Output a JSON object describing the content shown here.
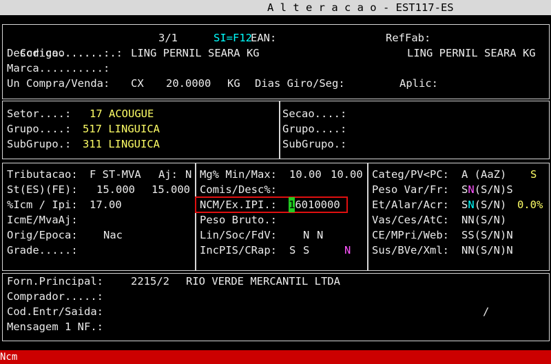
{
  "window_title": "A l t e r a c a o - EST117-ES",
  "product": {
    "codigo_label": "Codigo.........:",
    "codigo_value": "3/1",
    "si_f12": "SI=F12",
    "ean_label": "EAN:",
    "reffab_label": "RefFab:",
    "descricao_label": "Descricao......:",
    "descricao_value": "LING PERNIL SEARA KG",
    "descricao_right": "LING PERNIL SEARA KG",
    "marca_label": "Marca..........:",
    "uncv_label": "Un Compra/Venda:",
    "un_compra": "CX",
    "fator": "20.0000",
    "un_venda": "KG",
    "dias_giro_label": "Dias Giro/Seg:",
    "aplic_label": "Aplic:"
  },
  "classification": {
    "setor_label": "Setor....:",
    "setor_value": "17 ACOUGUE",
    "grupo_label": "Grupo....:",
    "grupo_value": "517 LINGUICA",
    "subgrupo_label": "SubGrupo.:",
    "subgrupo_value": "311 LINGUICA",
    "secao_label": "Secao....:",
    "grupo2_label": "Grupo....:",
    "subgrupo2_label": "SubGrupo.:"
  },
  "fiscal_left": {
    "tributacao_label": "Tributacao:",
    "tributacao_value": "F ST-MVA",
    "aj_label": "Aj:",
    "aj_value": "N",
    "st_label": "St(ES)(FE):",
    "st_value1": "15.000",
    "st_value2": "15.000",
    "icm_label": "%Icm / Ipi:",
    "icm_value": "17.00",
    "icme_label": "IcmE/MvaAj:",
    "orig_label": "Orig/Epoca:",
    "orig_value": "Nac",
    "grade_label": "Grade.....:"
  },
  "fiscal_mid": {
    "mg_label": "Mg% Min/Max:",
    "mg_value1": "10.00",
    "mg_value2": "10.00",
    "comis_label": "Comis/Desc%:",
    "ncm_label": "NCM/Ex.IPI.:",
    "ncm_cursor": "1",
    "ncm_rest": "6010000",
    "peso_bruto_label": "Peso Bruto.:",
    "lin_label": "Lin/Soc/FdV:",
    "lin_value1": "N",
    "lin_value2": "N",
    "inc_label": "IncPIS/CRap:",
    "inc_value1": "S",
    "inc_value2": "S",
    "inc_value3": "N"
  },
  "fiscal_right": {
    "categ_label": "Categ/PV<PC:",
    "categ_value": "A (AaZ)",
    "categ_flag": "S",
    "peso_label": "Peso Var/Fr:",
    "peso_s": "S",
    "peso_n": "N",
    "peso_rest": "(S/N)S",
    "et_label": "Et/Alar/Acr:",
    "et_s": "S",
    "et_n": "N",
    "et_rest": "(S/N)",
    "et_pct": "0.0%",
    "vas_label": "Vas/Ces/AtC:",
    "vas_value": "NN(S/N)",
    "ce_label": "CE/MPri/Web:",
    "ce_value": "SS(S/N)N",
    "sus_label": "Sus/BVe/Xml:",
    "sus_value": "NN(S/N)N"
  },
  "supplier": {
    "forn_label": "Forn.Principal:",
    "forn_code": "2215/2",
    "forn_name": "RIO VERDE MERCANTIL LTDA",
    "comprador_label": "Comprador.....:",
    "cod_label": "Cod.Entr/Saida:",
    "cod_slash": "/",
    "msg_label": "Mensagem 1 NF.:"
  },
  "status_bar": "Ncm",
  "colors": {
    "title_bg": "#d9d9d9",
    "status_bg": "#cc0000",
    "highlight_border": "#e01010",
    "cursor_bg": "#22cc22",
    "yellow": "#ffff66",
    "cyan": "#00ffff",
    "magenta": "#ff55ff"
  }
}
